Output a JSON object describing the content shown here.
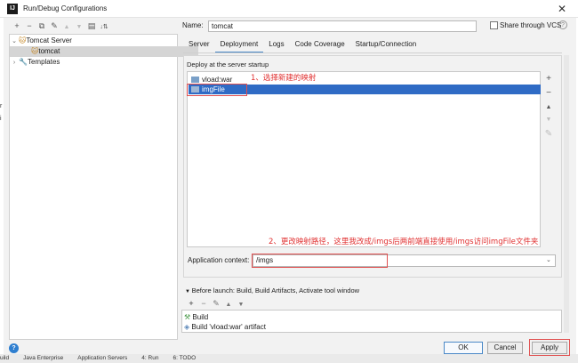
{
  "window": {
    "title": "Run/Debug Configurations",
    "app_icon": "IJ"
  },
  "tree_toolbar": {
    "add": "+",
    "remove": "−",
    "copy": "⧉",
    "edit": "✎",
    "up": "▲",
    "down": "▼",
    "folder": "▤",
    "sort": "↓⇅"
  },
  "tree": {
    "root": {
      "label": "Tomcat Server",
      "expanded": true
    },
    "child": {
      "label": "tomcat",
      "selected": true
    },
    "templates": {
      "label": "Templates"
    }
  },
  "name": {
    "label": "Name:",
    "value": "tomcat"
  },
  "share": {
    "label": "Share through VCS",
    "checked": false,
    "help": "?"
  },
  "tabs": [
    "Server",
    "Deployment",
    "Logs",
    "Code Coverage",
    "Startup/Connection"
  ],
  "active_tab": "Deployment",
  "deploy": {
    "label": "Deploy at the server startup",
    "items": [
      {
        "label": "vload:war",
        "selected": false
      },
      {
        "label": "imgFile",
        "selected": true
      }
    ],
    "side_buttons": {
      "add": "+",
      "remove": "−",
      "up": "▲",
      "down": "▼",
      "edit": "✎"
    }
  },
  "context": {
    "label": "Application context:",
    "value": "/imgs"
  },
  "before_launch": {
    "label": "Before launch: Build, Build Artifacts, Activate tool window",
    "items": [
      "Build",
      "Build 'vload:war' artifact"
    ]
  },
  "buttons": {
    "ok": "OK",
    "cancel": "Cancel",
    "apply": "Apply",
    "help": "?"
  },
  "annotations": {
    "step1": "1、选择新建的映射",
    "step2": "2、更改映射路径，这里我改成/imgs后两前端直接使用/imgs访问imgFile文件夹"
  },
  "statusbar": [
    "uild",
    "Java Enterprise",
    "Application Servers",
    "4: Run",
    "6: TODO"
  ],
  "colors": {
    "selection": "#2f6bc5",
    "annotation": "#e03030",
    "tab_underline": "#4a88c7"
  }
}
